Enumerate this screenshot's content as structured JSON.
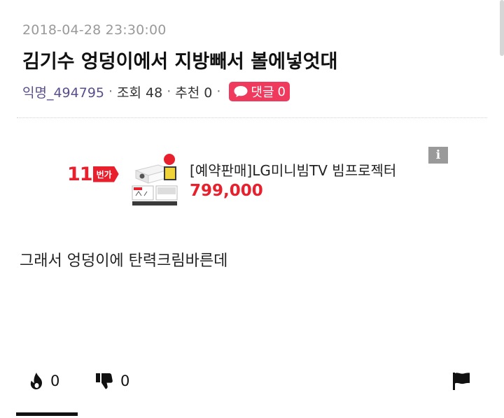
{
  "post": {
    "timestamp": "2018-04-28 23:30:00",
    "title": "김기수 엉덩이에서 지방빼서 볼에넣엇대",
    "author": "익명_494795",
    "views_text": "조회 48",
    "recommend_text": "추천 0",
    "comment_label": "댓글",
    "comment_count": "0",
    "body": "그래서 엉덩이에 탄력크림바른데"
  },
  "ad": {
    "logo_number": "11",
    "logo_tag": "번가",
    "product_name": "[예약판매]LG미니빔TV 빔프로젝터",
    "price": "799,000",
    "info_label": "i"
  },
  "actions": {
    "like_count": "0",
    "dislike_count": "0"
  },
  "colors": {
    "badge": "#ef3a5d",
    "price": "#e8202d",
    "author": "#5a4e8c",
    "timestamp": "#9a9a9a"
  },
  "icons": {
    "like": "flame-icon",
    "dislike": "thumbs-down-icon",
    "report": "flag-icon",
    "comment": "speech-bubble-icon"
  }
}
